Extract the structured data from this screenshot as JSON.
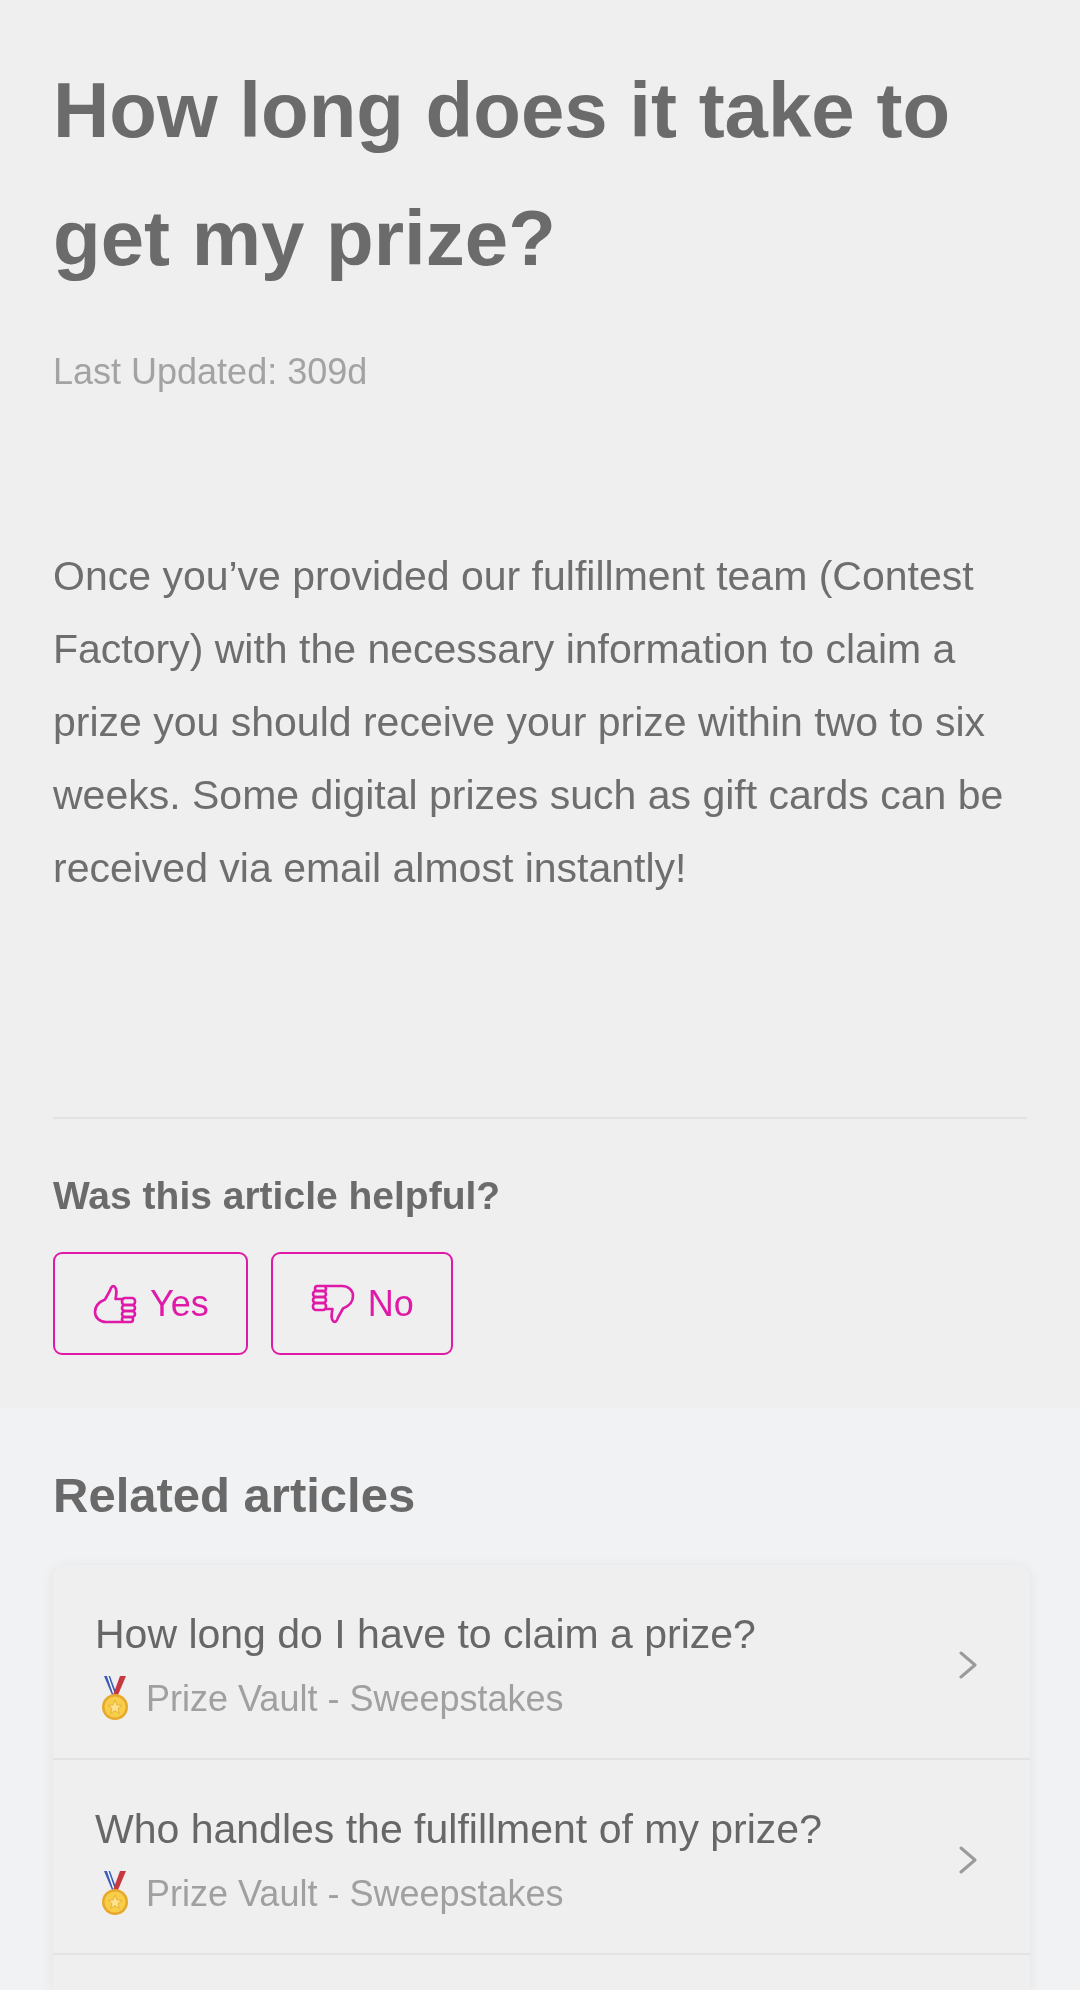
{
  "article": {
    "title": "How long does it take to get my prize?",
    "last_updated": "Last Updated: 309d",
    "body": "Once you’ve provided our fulfillment team (Contest Factory) with the necessary information to claim a prize you should receive your prize within two to six weeks. Some digital prizes such as gift cards can be received via email almost instantly!"
  },
  "feedback": {
    "question": "Was this article helpful?",
    "buttons": [
      {
        "label": "Yes",
        "kind": "up"
      },
      {
        "label": "No",
        "kind": "down"
      }
    ]
  },
  "related": {
    "heading": "Related articles",
    "items": [
      {
        "title": "How long do I have to claim a prize?",
        "category": "Prize Vault - Sweepstakes"
      },
      {
        "title": "Who handles the fulfillment of my prize?",
        "category": "Prize Vault - Sweepstakes"
      }
    ]
  }
}
